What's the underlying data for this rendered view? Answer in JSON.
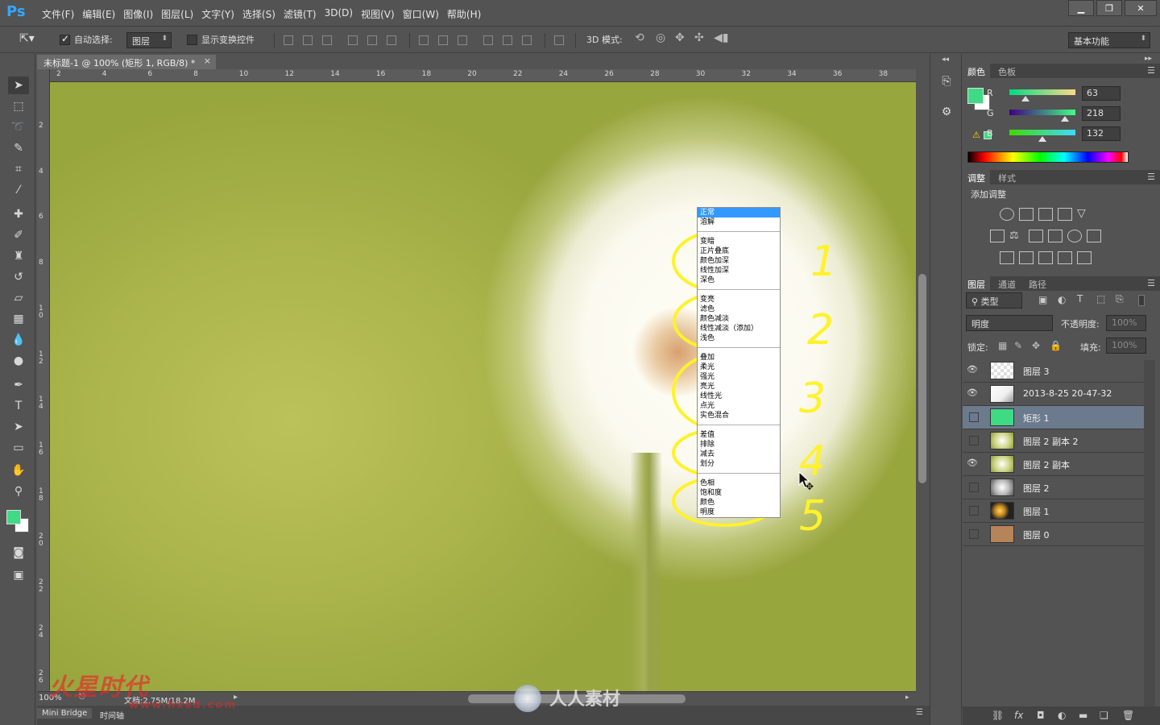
{
  "app": {
    "logo": "Ps",
    "menu": [
      "文件(F)",
      "编辑(E)",
      "图像(I)",
      "图层(L)",
      "文字(Y)",
      "选择(S)",
      "滤镜(T)",
      "3D(D)",
      "视图(V)",
      "窗口(W)",
      "帮助(H)"
    ],
    "window_buttons": {
      "minimize": "▁",
      "restore": "❐",
      "close": "✕"
    }
  },
  "options_bar": {
    "auto_select_label": "自动选择:",
    "auto_select_checked": true,
    "auto_select_target": "图层",
    "show_transform_label": "显示变换控件",
    "mode_3d_label": "3D 模式:",
    "workspace": "基本功能"
  },
  "document": {
    "tab_title": "未标题-1 @ 100% (矩形 1, RGB/8) *",
    "tab_close": "×",
    "ruler_h": [
      "2",
      "4",
      "6",
      "8",
      "10",
      "12",
      "14",
      "16",
      "18",
      "20",
      "22",
      "24",
      "26",
      "28",
      "30",
      "32",
      "34",
      "36",
      "38"
    ],
    "ruler_v": [
      "2",
      "4",
      "6",
      "8",
      "10",
      "12",
      "14",
      "16",
      "18",
      "20",
      "22",
      "24",
      "26"
    ],
    "zoom": "100%",
    "doc_info": "文档:2.75M/18.2M"
  },
  "blend_menu": {
    "groups": [
      [
        "正常",
        "溶解"
      ],
      [
        "变暗",
        "正片叠底",
        "颜色加深",
        "线性加深",
        "深色"
      ],
      [
        "变亮",
        "滤色",
        "颜色减淡",
        "线性减淡（添加）",
        "浅色"
      ],
      [
        "叠加",
        "柔光",
        "强光",
        "亮光",
        "线性光",
        "点光",
        "实色混合"
      ],
      [
        "差值",
        "排除",
        "减去",
        "划分"
      ],
      [
        "色相",
        "饱和度",
        "颜色",
        "明度"
      ]
    ],
    "selected": "正常"
  },
  "annotations": [
    "1",
    "2",
    "3",
    "4",
    "5"
  ],
  "bottom_tabs": [
    "Mini Bridge",
    "时间轴"
  ],
  "watermark": {
    "brand_cn": "火星时代",
    "url": "www.hxsd.com",
    "site": "人人素材"
  },
  "color_panel": {
    "tabs": [
      "颜色",
      "色板"
    ],
    "r_label": "R",
    "r": "63",
    "g_label": "G",
    "g": "218",
    "b_label": "B",
    "b": "132",
    "fg_color": "#3fda84",
    "bg_color": "#ffffff"
  },
  "adjust_panel": {
    "tabs": [
      "调整",
      "样式"
    ],
    "heading": "添加调整"
  },
  "layers_panel": {
    "tabs": [
      "图层",
      "通道",
      "路径"
    ],
    "filter_kind": "类型",
    "blend_mode": "明度",
    "opacity_label": "不透明度:",
    "opacity": "100%",
    "lock_label": "锁定:",
    "fill_label": "填充:",
    "fill": "100%",
    "layers": [
      {
        "name": "图层 3",
        "visible": true,
        "selected": false
      },
      {
        "name": "2013-8-25 20-47-32",
        "visible": true,
        "selected": false
      },
      {
        "name": "矩形 1",
        "visible": false,
        "selected": true
      },
      {
        "name": "图层 2 副本 2",
        "visible": false,
        "selected": false
      },
      {
        "name": "图层 2 副本",
        "visible": true,
        "selected": false
      },
      {
        "name": "图层 2",
        "visible": false,
        "selected": false
      },
      {
        "name": "图层 1",
        "visible": false,
        "selected": false
      },
      {
        "name": "图层 0",
        "visible": false,
        "selected": false
      }
    ],
    "bottom_icons": [
      "link-icon",
      "fx-icon",
      "mask-icon",
      "adjustment-icon",
      "folder-icon",
      "new-layer-icon",
      "trash-icon"
    ]
  }
}
